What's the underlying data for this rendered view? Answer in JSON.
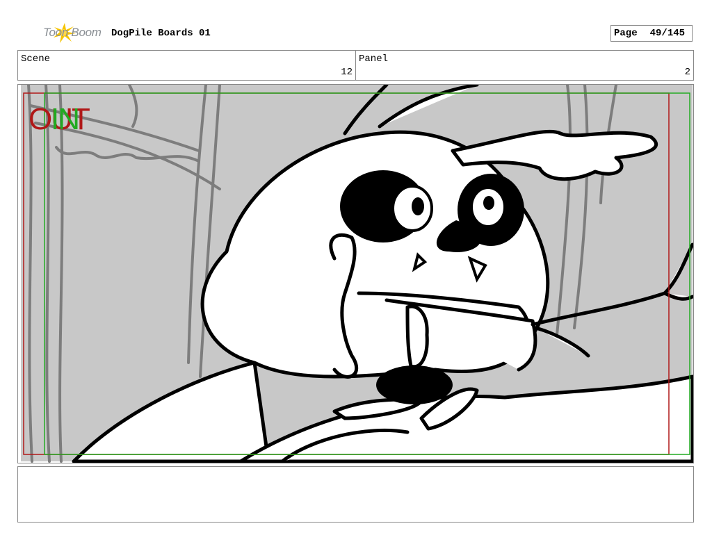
{
  "header": {
    "logo_text": "Toon Boom",
    "project_title": "DogPile Boards 01",
    "page_label": "Page",
    "page_value": "49/145"
  },
  "scene": {
    "label": "Scene",
    "value": "12"
  },
  "panel": {
    "label": "Panel",
    "value": "2"
  },
  "frame": {
    "in_label": "IN",
    "out_label": "OUT"
  },
  "notes": {
    "text": ""
  },
  "colors": {
    "border": "#888888",
    "sketch_gray": "#c8c8c8",
    "safe_red": "#b01818",
    "safe_green": "#22aa22",
    "logo_yellow": "#f5c400"
  }
}
